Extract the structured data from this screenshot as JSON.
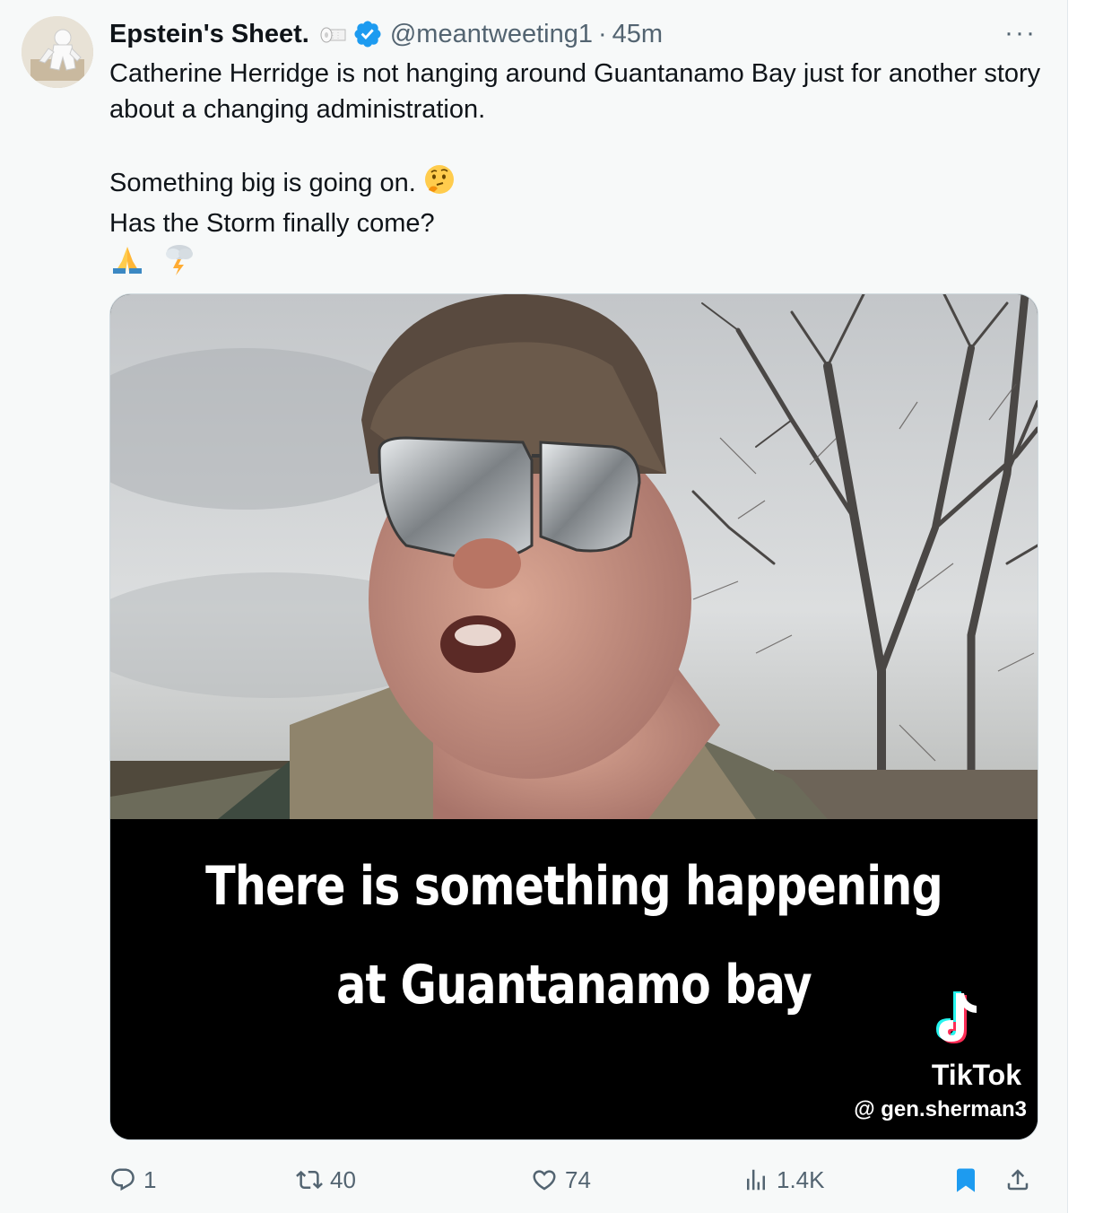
{
  "tweet": {
    "author_name": "Epstein's Sheet.",
    "handle": "@meantweeting1",
    "separator": "·",
    "time": "45m",
    "more_label": "···",
    "lines": [
      "Catherine Herridge is not hanging around Guantanamo Bay just for another story about a changing administration.",
      "Something big is going on.",
      "Has the Storm finally come?"
    ],
    "emojis": [
      "thinking-face",
      "folded-hands",
      "cloud-with-lightning"
    ]
  },
  "media": {
    "caption_line1": "There is something happening",
    "caption_line2": "at Guantanamo bay",
    "tiktok_label": "TikTok",
    "tiktok_user": "@ gen.sherman3"
  },
  "actions": {
    "replies": "1",
    "reposts": "40",
    "likes": "74",
    "views": "1.4K"
  },
  "colors": {
    "background": "#f7f9f9",
    "text": "#0f1419",
    "secondary": "#536471",
    "verified": "#1d9bf0",
    "bookmark": "#1d9bf0"
  }
}
